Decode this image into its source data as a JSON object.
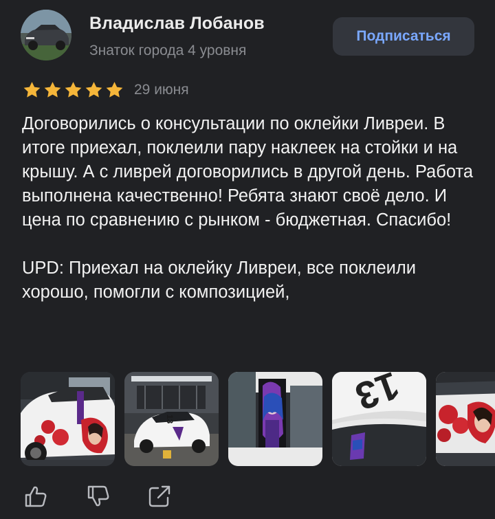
{
  "author": {
    "name": "Владислав Лобанов",
    "level": "Знаток города 4 уровня",
    "avatar_icon": "car-photo-avatar"
  },
  "subscribe_label": "Подписаться",
  "rating": {
    "stars": 5,
    "max": 5,
    "color": "#f5b63a"
  },
  "review": {
    "date": "29 июня",
    "paragraph_1": "Договорились о консультации по оклейки Ливреи. В итоге приехал, поклеили пару наклеек на стойки и на крышу. А с ливрей договорились в другой день. Работа выполнена качественно! Ребята знают своё дело. И цена по сравнению с рынком - бюджетная. Спасибо!",
    "paragraph_2": "UPD: Приехал на оклейку Ливреи, все поклеили хорошо, помогли с композицией,"
  },
  "photos": [
    {
      "icon": "car-livery-photo"
    },
    {
      "icon": "garage-car-photo"
    },
    {
      "icon": "pillar-sticker-photo"
    },
    {
      "icon": "roof-number-photo"
    },
    {
      "icon": "car-livery-closeup-photo"
    }
  ],
  "actions": [
    {
      "icon": "thumbs-up-icon"
    },
    {
      "icon": "thumbs-down-icon"
    },
    {
      "icon": "share-icon"
    }
  ],
  "colors": {
    "background": "#202124",
    "accent": "#7aa8ff",
    "button_bg": "#33363d",
    "secondary_text": "#8a8c91"
  }
}
